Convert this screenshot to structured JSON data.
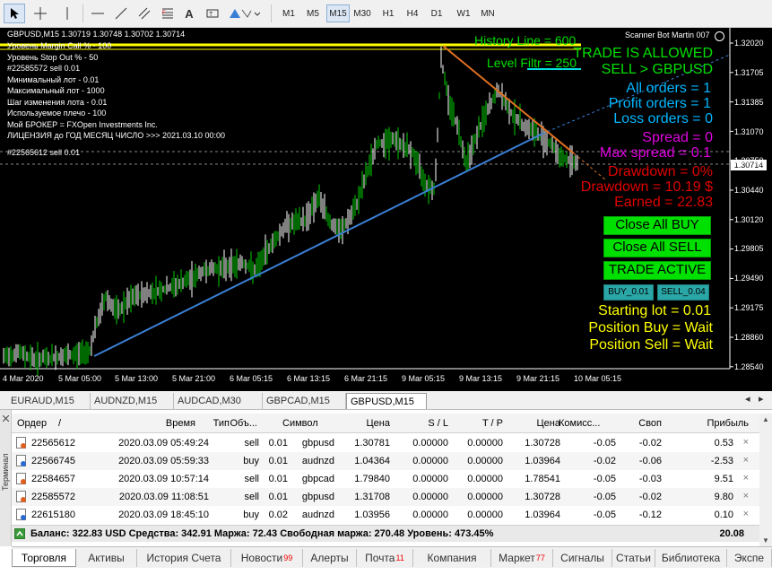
{
  "toolbar": {
    "tools": [
      "cursor-icon",
      "crosshair-icon",
      "vertical-line-icon",
      "horizontal-line-icon",
      "trendline-icon",
      "channel-icon",
      "fibonacci-icon",
      "text-icon",
      "label-icon",
      "shapes-icon"
    ],
    "timeframes": [
      "M1",
      "M5",
      "M15",
      "M30",
      "H1",
      "H4",
      "D1",
      "W1",
      "MN"
    ],
    "active_timeframe": "M15"
  },
  "chart": {
    "header": "GBPUSD,M15  1.30719 1.30748 1.30702 1.30714",
    "ea_name": "Scanner Bot Martin 007",
    "info_lines": [
      "Уровень Margin Call % - 100",
      "Уровень Stop Out % - 50",
      "#22585572 sell 0.01",
      "Минимальный лот -  0.01",
      "Максимальный лот -  1000",
      "Шаг изменения лота  -  0.01",
      "Используемое плечо -  100",
      "Мой БРОКЕР  =  FXOpen Investments Inc.",
      "ЛИЦЕНЗИЯ до ГОД  МЕСЯЦ  ЧИСЛО >>> 2021.03.10 00:00"
    ],
    "order_line_label": "#22565612 sell 0.01",
    "history_line": "History Line = 600",
    "level_filtr": "Level Filtr = 250",
    "trade_allowed": "TRADE IS ALLOWED",
    "signal": "SELL > GBPUSD",
    "all_orders": "All orders = 1",
    "profit_orders": "Profit orders = 1",
    "loss_orders": "Loss orders = 0",
    "spread": "Spread =  0",
    "max_spread": "Max spread = 0.1",
    "drawdown_pct": "Drawdown  = 0%",
    "drawdown_usd": "Drawdown = 10.19 $",
    "earned": "Earned = 22.83",
    "btn_close_buy": "Close All BUY",
    "btn_close_sell": "Close All SELL",
    "btn_trade_active": "TRADE ACTIVE",
    "btn_buy": "BUY_0.01",
    "btn_sell": "SELL_0.04",
    "starting_lot": "Starting lot = 0.01",
    "position_buy": "Position Buy  = Wait",
    "position_sell": "Position Sell = Wait",
    "current_price": "1.30714",
    "price_ticks": [
      "1.32020",
      "1.31705",
      "1.31385",
      "1.31070",
      "1.30750",
      "1.30440",
      "1.30120",
      "1.29805",
      "1.29490",
      "1.29175",
      "1.28860",
      "1.28540"
    ],
    "time_ticks": [
      "4 Mar 2020",
      "5 Mar 05:00",
      "5 Mar 13:00",
      "5 Mar 21:00",
      "6 Mar 05:15",
      "6 Mar 13:15",
      "6 Mar 21:15",
      "9 Mar 05:15",
      "9 Mar 13:15",
      "9 Mar 21:15",
      "10 Mar 05:15"
    ],
    "colors": {
      "bull": "#00d000",
      "history_line": "#ffff00",
      "trendline_up": "#3a7fd5",
      "trendline_down": "#e07020",
      "text_green": "#00e000",
      "text_cyan": "#00b7ff",
      "text_magenta": "#e000e0",
      "text_red": "#e00000",
      "text_yellow": "#ffff00"
    }
  },
  "symbol_tabs": [
    "EURAUD,M15",
    "AUDNZD,M15",
    "AUDCAD,M30",
    "GBPCAD,M15",
    "GBPUSD,M15"
  ],
  "active_symbol_tab": "GBPUSD,M15",
  "terminal": {
    "side_label": "Терминал",
    "columns": [
      "Ордер",
      "/",
      "Время",
      "Тип",
      "Объ...",
      "Символ",
      "Цена",
      "S / L",
      "T / P",
      "Цена",
      "Комисс...",
      "Своп",
      "Прибыль"
    ],
    "rows": [
      {
        "order": "22565612",
        "time": "2020.03.09 05:49:24",
        "type": "sell",
        "volume": "0.01",
        "symbol": "gbpusd",
        "price": "1.30781",
        "sl": "0.00000",
        "tp": "0.00000",
        "cur_price": "1.30728",
        "commission": "-0.05",
        "swap": "-0.02",
        "profit": "0.53"
      },
      {
        "order": "22566745",
        "time": "2020.03.09 05:59:33",
        "type": "buy",
        "volume": "0.01",
        "symbol": "audnzd",
        "price": "1.04364",
        "sl": "0.00000",
        "tp": "0.00000",
        "cur_price": "1.03964",
        "commission": "-0.02",
        "swap": "-0.06",
        "profit": "-2.53"
      },
      {
        "order": "22584657",
        "time": "2020.03.09 10:57:14",
        "type": "sell",
        "volume": "0.01",
        "symbol": "gbpcad",
        "price": "1.79840",
        "sl": "0.00000",
        "tp": "0.00000",
        "cur_price": "1.78541",
        "commission": "-0.05",
        "swap": "-0.03",
        "profit": "9.51"
      },
      {
        "order": "22585572",
        "time": "2020.03.09 11:08:51",
        "type": "sell",
        "volume": "0.01",
        "symbol": "gbpusd",
        "price": "1.31708",
        "sl": "0.00000",
        "tp": "0.00000",
        "cur_price": "1.30728",
        "commission": "-0.05",
        "swap": "-0.02",
        "profit": "9.80"
      },
      {
        "order": "22615180",
        "time": "2020.03.09 18:45:10",
        "type": "buy",
        "volume": "0.02",
        "symbol": "audnzd",
        "price": "1.03956",
        "sl": "0.00000",
        "tp": "0.00000",
        "cur_price": "1.03964",
        "commission": "-0.05",
        "swap": "-0.12",
        "profit": "0.10"
      }
    ],
    "balance_line": "Баланс: 322.83 USD  Средства: 342.91  Маржа: 72.43  Свободная маржа: 270.48  Уровень: 473.45%",
    "total_profit": "20.08"
  },
  "bottom_tabs": [
    {
      "label": "Торговля",
      "badge": ""
    },
    {
      "label": "Активы",
      "badge": ""
    },
    {
      "label": "История Счета",
      "badge": ""
    },
    {
      "label": "Новости",
      "badge": "99"
    },
    {
      "label": "Алерты",
      "badge": ""
    },
    {
      "label": "Почта",
      "badge": "11"
    },
    {
      "label": "Компания",
      "badge": ""
    },
    {
      "label": "Маркет",
      "badge": "77"
    },
    {
      "label": "Сигналы",
      "badge": ""
    },
    {
      "label": "Статьи",
      "badge": ""
    },
    {
      "label": "Библиотека",
      "badge": ""
    },
    {
      "label": "Экспе",
      "badge": ""
    }
  ],
  "active_bottom_tab": "Торговля"
}
